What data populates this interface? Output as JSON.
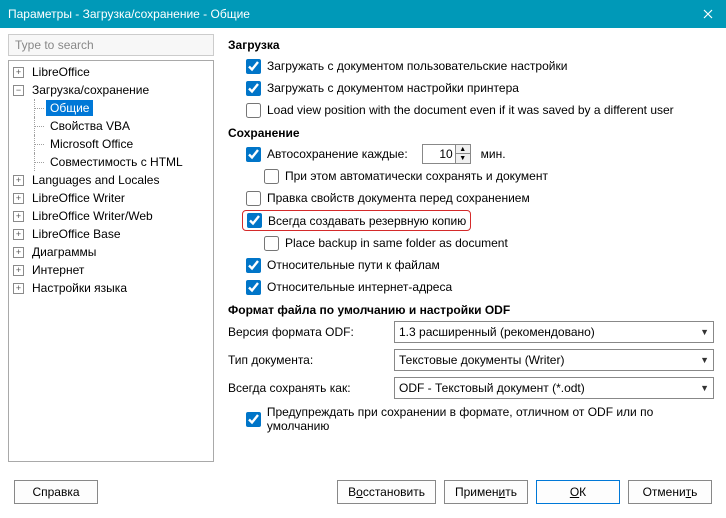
{
  "window": {
    "title": "Параметры - Загрузка/сохранение - Общие"
  },
  "search": {
    "placeholder": "Type to search"
  },
  "tree": {
    "items": [
      {
        "label": "LibreOffice",
        "toggle": "+"
      },
      {
        "label": "Загрузка/сохранение",
        "toggle": "−"
      },
      {
        "label": "Общие",
        "child": true,
        "selected": true
      },
      {
        "label": "Свойства VBA",
        "child": true
      },
      {
        "label": "Microsoft Office",
        "child": true
      },
      {
        "label": "Совместимость с HTML",
        "child": true
      },
      {
        "label": "Languages and Locales",
        "toggle": "+"
      },
      {
        "label": "LibreOffice Writer",
        "toggle": "+"
      },
      {
        "label": "LibreOffice Writer/Web",
        "toggle": "+"
      },
      {
        "label": "LibreOffice Base",
        "toggle": "+"
      },
      {
        "label": "Диаграммы",
        "toggle": "+"
      },
      {
        "label": "Интернет",
        "toggle": "+"
      },
      {
        "label": "Настройки языка",
        "toggle": "+"
      }
    ]
  },
  "load": {
    "heading": "Загрузка",
    "opt1": "Загружать с документом пользовательские настройки",
    "opt2": "Загружать с документом настройки принтера",
    "opt3": "Load view position with the document even if it was saved by a different user"
  },
  "save": {
    "heading": "Сохранение",
    "autosave_label": "Автосохранение каждые:",
    "autosave_value": "10",
    "autosave_unit": "мин.",
    "autosave_doc": "При этом автоматически сохранять и документ",
    "edit_props": "Правка свойств документа перед сохранением",
    "backup": "Всегда создавать резервную копию",
    "backup_same": "Place backup in same folder as document",
    "rel_files": "Относительные пути к файлам",
    "rel_inet": "Относительные интернет-адреса"
  },
  "fmt": {
    "heading": "Формат файла по умолчанию и настройки ODF",
    "odf_ver_label": "Версия формата ODF:",
    "odf_ver_value": "1.3 расширенный (рекомендовано)",
    "doctype_label": "Тип документа:",
    "doctype_value": "Текстовые документы (Writer)",
    "saveas_label": "Всегда сохранять как:",
    "saveas_value": "ODF - Текстовый документ (*.odt)",
    "warn": "Предупреждать при сохранении в формате, отличном от ODF или по умолчанию"
  },
  "buttons": {
    "help": "Справка",
    "reset_pre": "В",
    "reset_u": "о",
    "reset_post": "сстановить",
    "apply_pre": "Примен",
    "apply_u": "и",
    "apply_post": "ть",
    "ok_pre": "",
    "ok_u": "О",
    "ok_post": "К",
    "cancel_pre": "Отмени",
    "cancel_u": "т",
    "cancel_post": "ь"
  }
}
